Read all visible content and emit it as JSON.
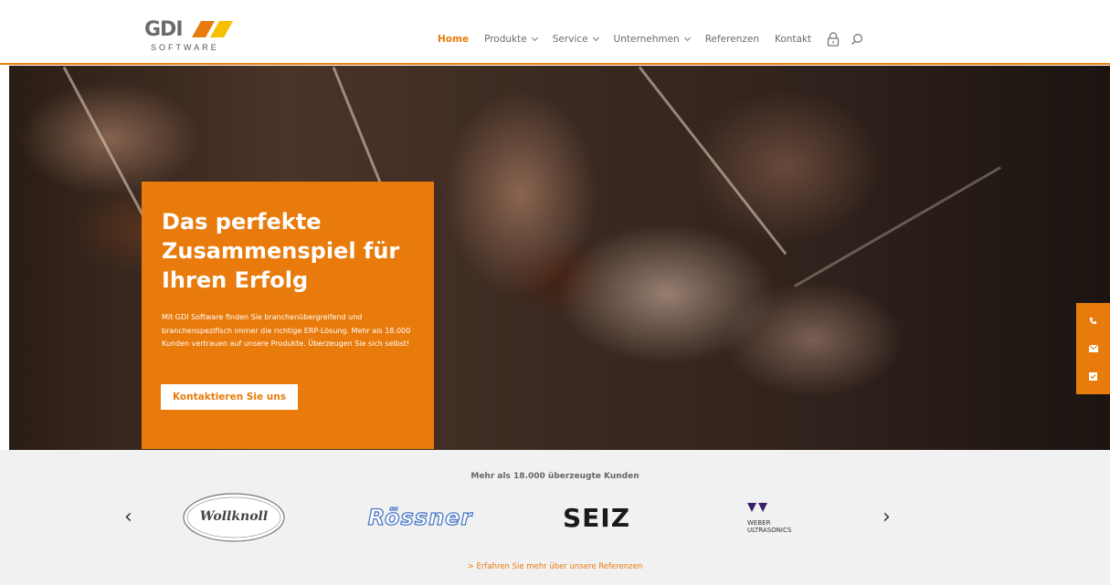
{
  "brand": {
    "logo_word": "GDI",
    "logo_sub": "SOFTWARE",
    "accent": "#e97b0c",
    "accent_yellow": "#f6c000"
  },
  "nav": {
    "items": [
      {
        "label": "Home",
        "active": true,
        "dropdown": false
      },
      {
        "label": "Produkte",
        "active": false,
        "dropdown": true
      },
      {
        "label": "Service",
        "active": false,
        "dropdown": true
      },
      {
        "label": "Unternehmen",
        "active": false,
        "dropdown": true
      },
      {
        "label": "Referenzen",
        "active": false,
        "dropdown": false
      },
      {
        "label": "Kontakt",
        "active": false,
        "dropdown": false
      }
    ],
    "icons": [
      "lock-icon",
      "search-icon"
    ]
  },
  "hero": {
    "title": "Das perfekte Zusammenspiel für Ihren Erfolg",
    "text": "Mit GDI Software finden Sie branchenübergreifend und branchenspezifisch immer die richtige ERP-Lösung. Mehr als 18.000 Kunden vertrauen auf unsere Produkte. Überzeugen Sie sich selbst!",
    "cta_label": "Kontaktieren Sie uns",
    "side_icons": [
      "phone-icon",
      "mail-icon",
      "form-icon"
    ]
  },
  "clients": {
    "heading": "Mehr als 18.000 überzeugte Kunden",
    "logos": [
      {
        "name": "Wollknoll",
        "text": "Wollknoll"
      },
      {
        "name": "Rössner",
        "text": "Rössner"
      },
      {
        "name": "Seiz",
        "text": "SEIZ"
      },
      {
        "name": "Weber Ultrasonics",
        "text_line1": "WEBER",
        "text_line2": "ULTRASONICS"
      }
    ],
    "prev_arrow": "‹",
    "next_arrow": "›",
    "more_link": "> Erfahren Sie mehr über unsere Referenzen"
  }
}
